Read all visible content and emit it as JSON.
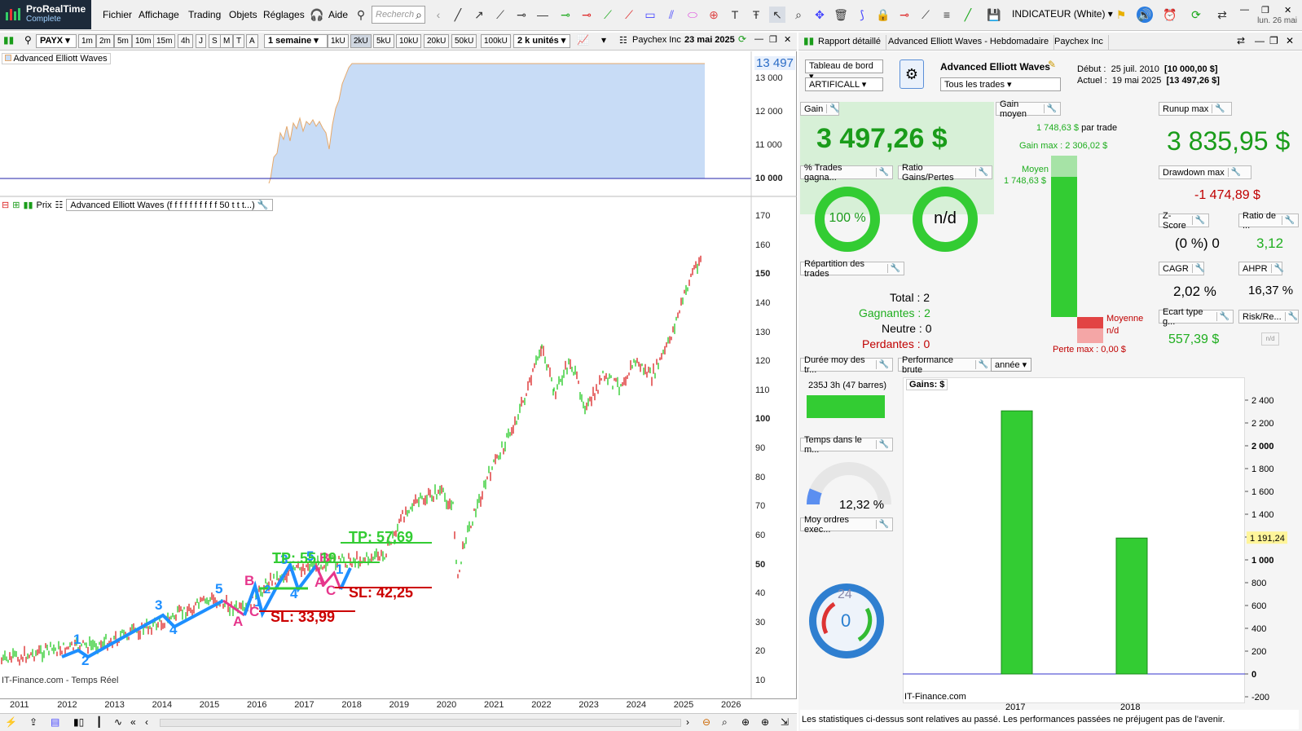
{
  "app": {
    "name": "ProRealTime",
    "edition": "Complete",
    "menu": [
      "Fichier",
      "Affichage",
      "Trading",
      "Objets",
      "Réglages",
      "Aide"
    ],
    "search_placeholder": "Recherch",
    "indicator_select": "INDICATEUR (White)",
    "date": "lun. 26 mai"
  },
  "chart_toolbar": {
    "symbol": "PAYX",
    "timeframes": [
      "1m",
      "2m",
      "5m",
      "10m",
      "15m",
      "4h",
      "J",
      "S",
      "M",
      "T",
      "A"
    ],
    "period": "1 semaine",
    "units": [
      "1kU",
      "2kU",
      "5kU",
      "10kU",
      "20kU",
      "50kU",
      "100kU"
    ],
    "active_unit": "2kU",
    "units_select": "2 k unités",
    "instrument": "Paychex Inc",
    "instrument_date": "23 mai 2025"
  },
  "equity_pane": {
    "title": "Advanced Elliott Waves",
    "current": "13 497",
    "y_ticks": [
      "13 000",
      "12 000",
      "11 000",
      "10 000"
    ]
  },
  "price_pane": {
    "legend_prix": "Prix",
    "legend_indicator": "Advanced Elliott Waves (f f f f f f f f f f 50 t t t...)",
    "y_ticks": [
      "170",
      "160",
      "150",
      "140",
      "130",
      "120",
      "110",
      "100",
      "90",
      "80",
      "70",
      "60",
      "50",
      "40",
      "30",
      "20",
      "10"
    ],
    "x_ticks": [
      "2011",
      "2012",
      "2013",
      "2014",
      "2015",
      "2016",
      "2017",
      "2018",
      "2019",
      "2020",
      "2021",
      "2022",
      "2023",
      "2024",
      "2025",
      "2026"
    ],
    "watermark": "IT-Finance.com - Temps Réel",
    "annotations": {
      "tp1": "TP: 57,69",
      "tp2": "TP: 55,19",
      "sl1": "SL: 42,25",
      "sl2": "SL: 33,99"
    },
    "wave_labels": [
      "1",
      "2",
      "3",
      "4",
      "5",
      "A",
      "B",
      "C",
      "1",
      "2",
      "3",
      "4",
      "5",
      "A",
      "B",
      "C",
      "1"
    ]
  },
  "report": {
    "tabs": [
      "Rapport détaillé",
      "Advanced Elliott Waves - Hebdomadaire",
      "Paychex Inc"
    ],
    "dashboard_select": "Tableau de bord",
    "account_select": "ARTIFICALL",
    "strategy_name": "Advanced Elliott Waves",
    "trades_select": "Tous les trades",
    "debut_label": "Début :",
    "debut_date": "25 juil. 2010",
    "debut_value": "[10 000,00 $]",
    "actuel_label": "Actuel :",
    "actuel_date": "19 mai 2025",
    "actuel_value": "[13 497,26 $]",
    "gain_label": "Gain",
    "gain_value": "3 497,26 $",
    "gain_moyen_label": "Gain moyen",
    "gain_moyen_value": "1 748,63 $",
    "par_trade": "par trade",
    "gain_max": "Gain max : 2 306,02 $",
    "moyen_label": "Moyen",
    "moyen_value": "1 748,63 $",
    "moyenne_label": "Moyenne",
    "moyenne_value": "n/d",
    "perte_max": "Perte max : 0,00 $",
    "runup_label": "Runup max",
    "runup_value": "3 835,95 $",
    "drawdown_label": "Drawdown max",
    "drawdown_value": "-1 474,89 $",
    "pct_trades_label": "% Trades gagna...",
    "pct_trades_value": "100 %",
    "pct_trades_fraction": 1.0,
    "ratio_label": "Ratio Gains/Pertes",
    "ratio_value": "n/d",
    "zscore_label": "Z-Score",
    "zscore_value": "(0 %) 0",
    "ratio_de_label": "Ratio de ...",
    "ratio_de_value": "3,12",
    "repartition_label": "Répartition des trades",
    "total_label": "Total : 2",
    "gagnantes_label": "Gagnantes : 2",
    "neutre_label": "Neutre : 0",
    "perdantes_label": "Perdantes : 0",
    "cagr_label": "CAGR",
    "cagr_value": "2,02 %",
    "ahpr_label": "AHPR",
    "ahpr_value": "16,37 %",
    "ecart_label": "Ecart type g...",
    "ecart_value": "557,39 $",
    "risk_label": "Risk/Re...",
    "risk_value": "n/d",
    "duree_label": "Durée moy des tr...",
    "duree_value": "235J 3h (47 barres)",
    "perf_label": "Performance brute",
    "perf_period": "année",
    "temps_label": "Temps dans le m...",
    "temps_value": "12,32 %",
    "temps_fraction": 0.1232,
    "moy_ordres_label": "Moy ordres exec...",
    "clock_value": "0",
    "clock_number": "24",
    "gains_label": "Gains: $",
    "footer_note": "Les statistiques ci-dessus sont relatives au passé. Les performances passées ne préjugent pas de l'avenir.",
    "watermark": "IT-Finance.com"
  },
  "chart_data": {
    "type": "bar",
    "title": "Gains: $",
    "categories": [
      "2017",
      "2018"
    ],
    "values": [
      2306.02,
      1191.24
    ],
    "ylim": [
      -200,
      2500
    ],
    "y_ticks": [
      "2 400",
      "2 200",
      "2 000",
      "1 800",
      "1 600",
      "1 400",
      "1 200",
      "1 000",
      "800",
      "600",
      "400",
      "200",
      "0",
      "-200"
    ],
    "highlight": "1 191,24",
    "colors": {
      "bar": "#33cc33",
      "zero_line": "#3333cc"
    }
  },
  "colors": {
    "accent_green": "#33cc33",
    "dark_green": "#1a9c1a",
    "red": "#cc0000",
    "wave_blue": "#1e8fff",
    "wave_pink": "#e6368c"
  }
}
